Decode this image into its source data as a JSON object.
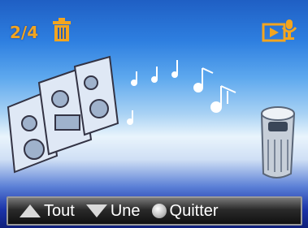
{
  "header": {
    "counter": "2/4",
    "delete_icon": "trash-icon",
    "media_icon": "slideshow-audio-icon",
    "accent_color": "#f3a51f"
  },
  "footer": {
    "buttons": [
      {
        "icon": "triangle-up-icon",
        "label": "Tout"
      },
      {
        "icon": "triangle-down-icon",
        "label": "Une"
      },
      {
        "icon": "round-button-icon",
        "label": "Quitter"
      }
    ]
  }
}
